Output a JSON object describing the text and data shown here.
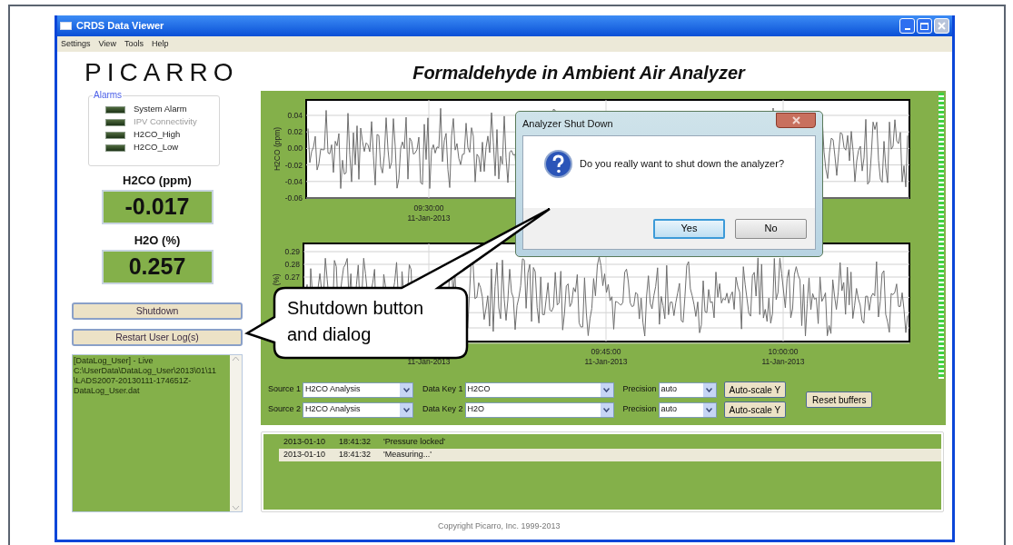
{
  "window": {
    "title": "CRDS Data Viewer"
  },
  "menu": [
    "Settings",
    "View",
    "Tools",
    "Help"
  ],
  "logo": "PICARRO",
  "page_title": "Formaldehyde in Ambient Air Analyzer",
  "alarms": {
    "title": "Alarms",
    "items": [
      {
        "label": "System Alarm",
        "disabled": false
      },
      {
        "label": "IPV Connectivity",
        "disabled": true
      },
      {
        "label": "H2CO_High",
        "disabled": false
      },
      {
        "label": "H2CO_Low",
        "disabled": false
      }
    ]
  },
  "readouts": [
    {
      "label": "H2CO (ppm)",
      "value": "-0.017"
    },
    {
      "label": "H2O (%)",
      "value": "0.257"
    }
  ],
  "buttons": [
    "Shutdown",
    "Restart User Log(s)"
  ],
  "user_log": "[DataLog_User] - Live\nC:\\UserData\\DataLog_User\\2013\\01\\11\n\\LADS2007-20130111-174651Z-\nDataLog_User.dat",
  "charts": [
    {
      "ylabel": "H2CO (ppm)",
      "yticks": [
        "0.04",
        "0.02",
        "0.00",
        "-0.02",
        "-0.04",
        "-0.06"
      ],
      "xticks": [
        {
          "time": "09:30:00",
          "date": "11-Jan-2013"
        }
      ]
    },
    {
      "ylabel": "(%)",
      "yticks": [
        "0.29",
        "0.28",
        "0.27"
      ],
      "xticks": [
        {
          "date": "11-Jan-2013"
        },
        {
          "time": "09:45:00",
          "date": "11-Jan-2013"
        },
        {
          "time": "10:00:00",
          "date": "11-Jan-2013"
        }
      ]
    }
  ],
  "controls": [
    {
      "source_label": "Source 1",
      "source": "H2CO Analysis",
      "key_label": "Data Key 1",
      "key": "H2CO",
      "precision_label": "Precision",
      "precision": "auto",
      "autoscale": "Auto-scale Y"
    },
    {
      "source_label": "Source 2",
      "source": "H2CO Analysis",
      "key_label": "Data Key 2",
      "key": "H2O",
      "precision_label": "Precision",
      "precision": "auto",
      "autoscale": "Auto-scale Y"
    }
  ],
  "reset_button": "Reset buffers",
  "event_log": [
    {
      "date": "2013-01-10",
      "time": "18:41:32",
      "message": "'Pressure locked'",
      "selected": false
    },
    {
      "date": "2013-01-10",
      "time": "18:41:32",
      "message": "'Measuring...'",
      "selected": true
    }
  ],
  "copyright": "Copyright Picarro, Inc. 1999-2013",
  "dialog": {
    "title": "Analyzer Shut Down",
    "message": "Do you really want to shut down the analyzer?",
    "buttons": [
      {
        "label": "Yes",
        "focused": true
      },
      {
        "label": "No",
        "focused": false
      }
    ]
  },
  "callout": "Shutdown button\nand dialog"
}
